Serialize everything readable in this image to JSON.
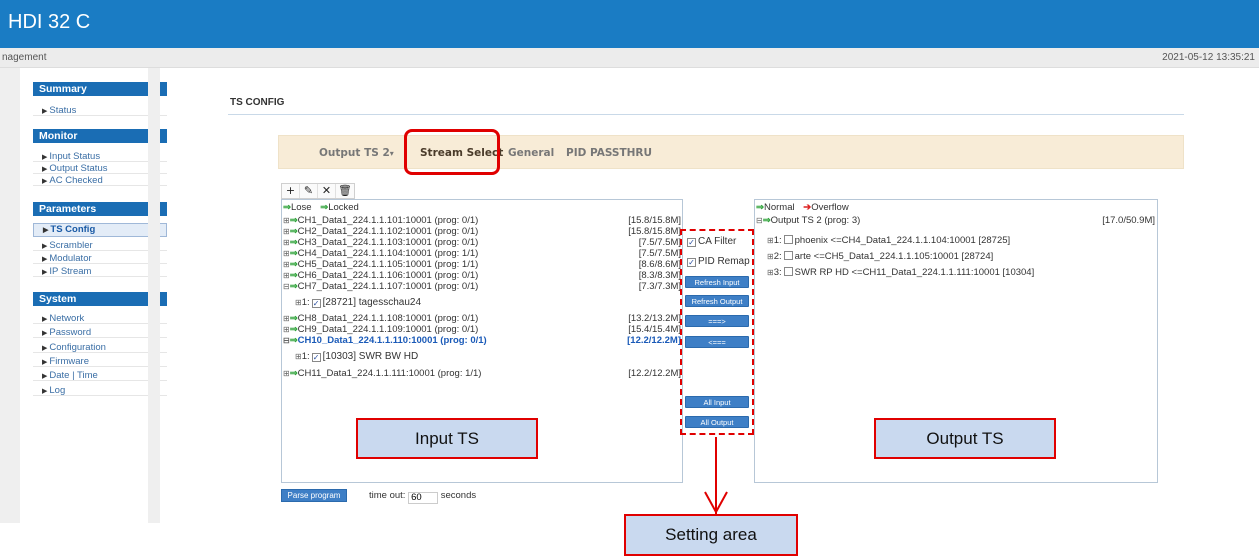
{
  "app": {
    "title": "HDI 32 C"
  },
  "subbar": {
    "left": "nagement",
    "datetime": "2021-05-12 13:35:21"
  },
  "sidebar": {
    "summary": {
      "title": "Summary",
      "items": [
        "Status"
      ]
    },
    "monitor": {
      "title": "Monitor",
      "items": [
        "Input Status",
        "Output Status",
        "AC Checked"
      ]
    },
    "parameters": {
      "title": "Parameters",
      "items": [
        "TS Config",
        "Scrambler",
        "Modulator",
        "IP Stream"
      ],
      "active": "TS Config"
    },
    "system": {
      "title": "System",
      "items": [
        "Network",
        "Password",
        "Configuration",
        "Firmware",
        "Date | Time",
        "Log"
      ]
    }
  },
  "page": {
    "title": "TS CONFIG"
  },
  "tabs": [
    {
      "label": "Output TS 2",
      "dropdown": true
    },
    {
      "label": "Stream Select",
      "active": true
    },
    {
      "label": "General"
    },
    {
      "label": "PID PASSTHRU"
    }
  ],
  "toolbar": {
    "icons": [
      "plus-icon",
      "pencil-icon",
      "close-icon",
      "trash-icon"
    ],
    "glyphs": [
      "+",
      "✎",
      "✕",
      "🗑"
    ]
  },
  "input_panel": {
    "legend": {
      "lose": "Lose",
      "locked": "Locked"
    },
    "channels": [
      {
        "name": "CH1_Data1_224.1.1.101:10001 (prog: 0/1)",
        "rate": "[15.8/15.8M]"
      },
      {
        "name": "CH2_Data1_224.1.1.102:10001 (prog: 0/1)",
        "rate": "[15.8/15.8M]"
      },
      {
        "name": "CH3_Data1_224.1.1.103:10001 (prog: 0/1)",
        "rate": "[7.5/7.5M]"
      },
      {
        "name": "CH4_Data1_224.1.1.104:10001 (prog: 1/1)",
        "rate": "[7.5/7.5M]"
      },
      {
        "name": "CH5_Data1_224.1.1.105:10001 (prog: 1/1)",
        "rate": "[8.6/8.6M]"
      },
      {
        "name": "CH6_Data1_224.1.1.106:10001 (prog: 0/1)",
        "rate": "[8.3/8.3M]"
      },
      {
        "name": "CH7_Data1_224.1.1.107:10001 (prog: 0/1)",
        "rate": "[7.3/7.3M]",
        "expanded": true,
        "child": "[28721] tagesschau24",
        "child_index": "1:"
      },
      {
        "name": "CH8_Data1_224.1.1.108:10001 (prog: 0/1)",
        "rate": "[13.2/13.2M]"
      },
      {
        "name": "CH9_Data1_224.1.1.109:10001 (prog: 0/1)",
        "rate": "[15.4/15.4M]"
      },
      {
        "name": "CH10_Data1_224.1.1.110:10001 (prog: 0/1)",
        "rate": "[12.2/12.2M]",
        "selected": true,
        "expanded": true,
        "child": "[10303] SWR BW HD",
        "child_index": "1:"
      },
      {
        "name": "CH11_Data1_224.1.1.111:10001 (prog: 1/1)",
        "rate": "[12.2/12.2M]"
      }
    ]
  },
  "controls": {
    "ca_filter": "CA Filter",
    "pid_remap": "PID Remap",
    "refresh_input": "Refresh Input",
    "refresh_output": "Refresh Output",
    "move_right": "===>",
    "move_left": "<===",
    "all_input": "All Input",
    "all_output": "All Output"
  },
  "output_panel": {
    "legend": {
      "normal": "Normal",
      "overflow": "Overflow"
    },
    "root": {
      "name": "Output TS 2 (prog: 3)",
      "rate": "[17.0/50.9M]"
    },
    "programs": [
      {
        "index": "1:",
        "label": "phoenix <=CH4_Data1_224.1.1.104:10001 [28725]"
      },
      {
        "index": "2:",
        "label": "arte <=CH5_Data1_224.1.1.105:10001 [28724]"
      },
      {
        "index": "3:",
        "label": "SWR RP HD <=CH11_Data1_224.1.1.111:10001 [10304]"
      }
    ]
  },
  "bottom": {
    "parse_button": "Parse program",
    "timeout_label": "time out:",
    "timeout_value": "60",
    "timeout_unit": "seconds"
  },
  "callouts": {
    "input": "Input TS",
    "output": "Output TS",
    "setting": "Setting area"
  },
  "colors": {
    "header": "#1a7cc4",
    "highlight": "#e00000",
    "callout_bg": "#c9d9ef",
    "tab_bg": "#f8ecd7"
  }
}
